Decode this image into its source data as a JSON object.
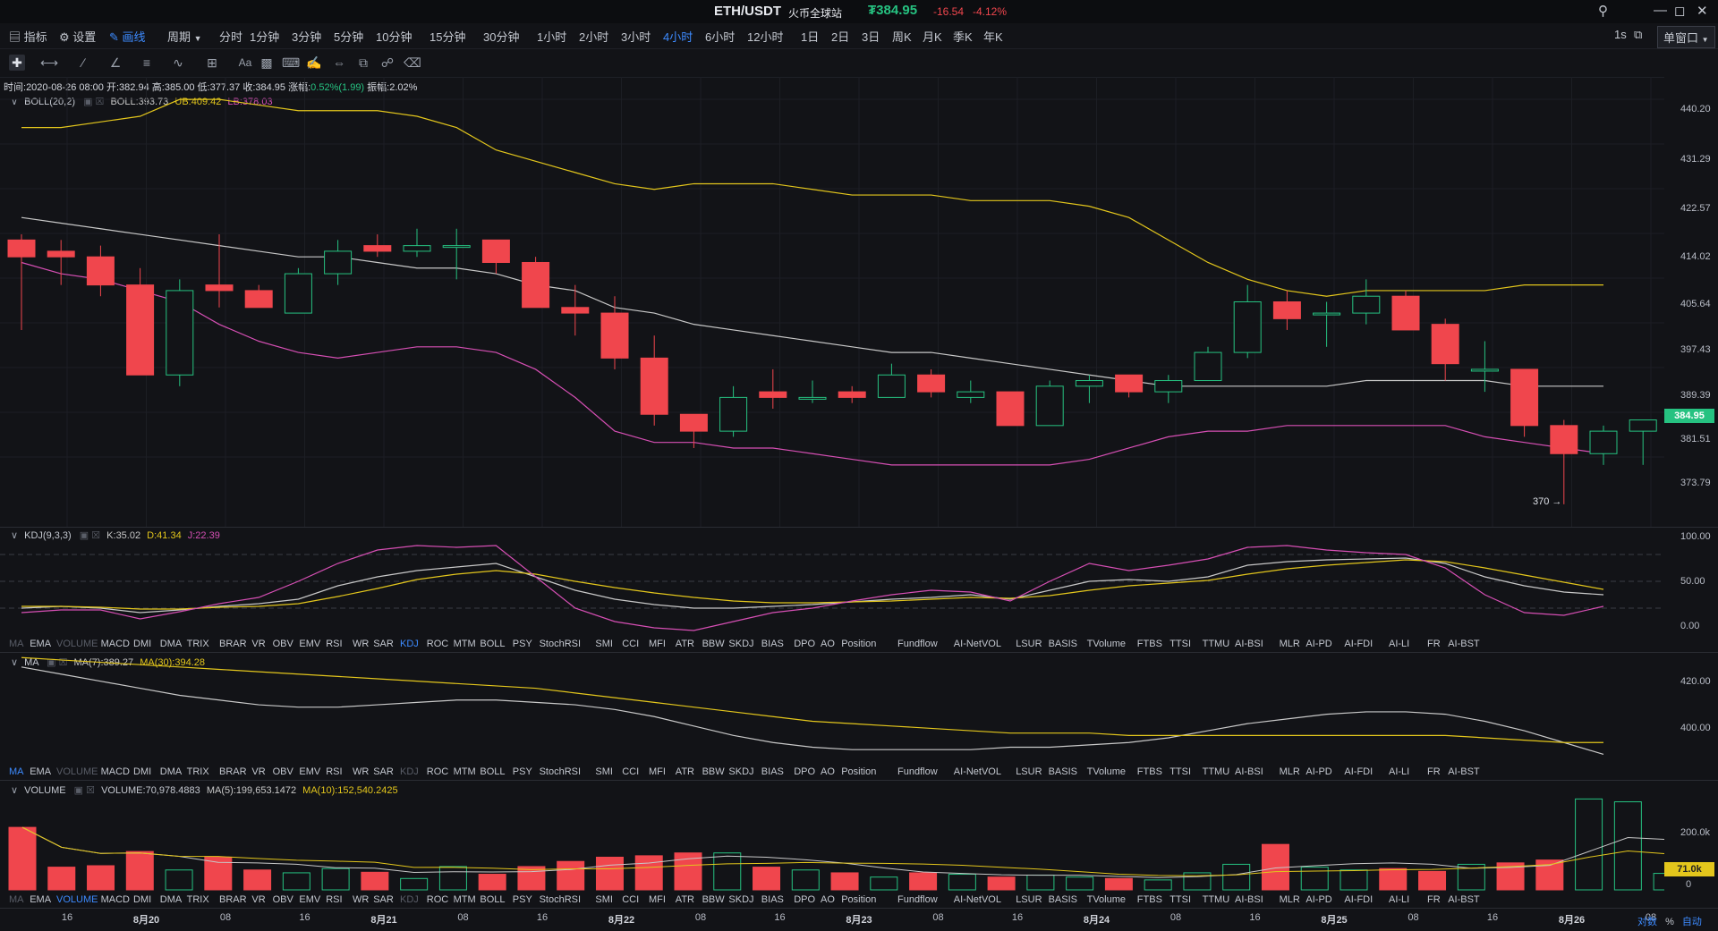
{
  "titlebar": {
    "pair": "ETH/USDT",
    "exchange": "火币全球站",
    "price": "₮384.95",
    "change": "-16.54",
    "change_pct": "-4.12%",
    "price_color": "#26c281",
    "change_color": "#f0464d"
  },
  "toolbar": {
    "indicators_label": "指标",
    "settings_label": "设置",
    "draw_label": "画线",
    "period_label": "周期",
    "periods": [
      "分时",
      "1分钟",
      "3分钟",
      "5分钟",
      "10分钟",
      "15分钟",
      "30分钟",
      "1小时",
      "2小时",
      "3小时",
      "4小时",
      "6小时",
      "12小时",
      "1日",
      "2日",
      "3日",
      "周K",
      "月K",
      "季K",
      "年K"
    ],
    "active_period": "4小时",
    "refresh": "1s",
    "window_mode": "单窗口"
  },
  "drawing_tools": [
    "crosshair-icon",
    "horizontal-line-icon",
    "trend-line-icon",
    "angle-icon",
    "parallel-lines-icon",
    "wave-icon",
    "grid-icon",
    "text-icon",
    "pattern-icon",
    "ruler-icon",
    "pen-icon",
    "measure-icon",
    "lock-icon",
    "trash-icon"
  ],
  "text_tool_label": "Aa",
  "ohlc_info": {
    "time_label": "时间:",
    "time": "2020-08-26 08:00",
    "open_label": "开:",
    "open": "382.94",
    "high_label": "高:",
    "high": "385.00",
    "low_label": "低:",
    "low": "377.37",
    "close_label": "收:",
    "close": "384.95",
    "change_label": "涨幅:",
    "change": "0.52%(1.99)",
    "amp_label": "振幅:",
    "amp": "2.02%"
  },
  "boll_legend": {
    "name": "BOLL(20,2)",
    "boll": "BOLL:393.73",
    "ub": "UB:409.42",
    "lb": "LB:378.03"
  },
  "kdj_legend": {
    "name": "KDJ(9,3,3)",
    "k": "K:35.02",
    "d": "D:41.34",
    "j": "J:22.39"
  },
  "ma_legend": {
    "name": "MA",
    "ma7": "MA(7):389.27",
    "ma30": "MA(30):394.28"
  },
  "vol_legend": {
    "name": "VOLUME",
    "vol": "VOLUME:70,978.4883",
    "ma5": "MA(5):199,653.1472",
    "ma10": "MA(10):152,540.2425"
  },
  "indicator_tabs": [
    "MA",
    "EMA",
    "VOLUME",
    "MACD",
    "DMI",
    "DMA",
    "TRIX",
    "BRAR",
    "VR",
    "OBV",
    "EMV",
    "RSI",
    "WR",
    "SAR",
    "KDJ",
    "ROC",
    "MTM",
    "BOLL",
    "PSY",
    "StochRSI",
    "SMI",
    "CCI",
    "MFI",
    "ATR",
    "BBW",
    "SKDJ",
    "BIAS",
    "DPO",
    "AO",
    "Position",
    "Fundflow",
    "AI-NetVOL",
    "LSUR",
    "BASIS",
    "TVolume",
    "FTBS",
    "TTSI",
    "TTMU",
    "AI-BSI",
    "MLR",
    "AI-PD",
    "AI-FDI",
    "AI-LI",
    "FR",
    "AI-BST"
  ],
  "price_axis": [
    "440.20",
    "431.29",
    "422.57",
    "414.02",
    "405.64",
    "397.43",
    "389.39",
    "381.51",
    "373.79"
  ],
  "current_price_tag": "384.95",
  "low_marker": "370 →",
  "kdj_axis": [
    "100.00",
    "50.00",
    "0.00"
  ],
  "ma_axis": [
    "420.00",
    "400.00"
  ],
  "vol_axis": [
    "200.0k",
    "0"
  ],
  "vol_tag": "71.0k",
  "time_axis": [
    "16",
    "8月20",
    "08",
    "16",
    "8月21",
    "08",
    "16",
    "8月22",
    "08",
    "16",
    "8月23",
    "08",
    "16",
    "8月24",
    "08",
    "16",
    "8月25",
    "08",
    "16",
    "8月26",
    "08"
  ],
  "bottom_right": {
    "log": "对数",
    "pct": "%",
    "auto": "自动"
  },
  "colors": {
    "up": "#26c281",
    "down": "#f0464d",
    "ub": "#e3c61c",
    "mid": "#c8c8c8",
    "lb": "#d64fb4",
    "accent": "#3d8bff"
  },
  "chart_data": {
    "type": "candlestick",
    "candles": [
      {
        "o": 417,
        "h": 418,
        "l": 401,
        "c": 414
      },
      {
        "o": 415,
        "h": 417,
        "l": 409,
        "c": 414
      },
      {
        "o": 414,
        "h": 416,
        "l": 407,
        "c": 409
      },
      {
        "o": 409,
        "h": 412,
        "l": 393,
        "c": 393
      },
      {
        "o": 393,
        "h": 410,
        "l": 391,
        "c": 408
      },
      {
        "o": 409,
        "h": 418,
        "l": 405,
        "c": 408
      },
      {
        "o": 408,
        "h": 409,
        "l": 405,
        "c": 405
      },
      {
        "o": 404,
        "h": 412,
        "l": 404,
        "c": 411
      },
      {
        "o": 411,
        "h": 417,
        "l": 409,
        "c": 415
      },
      {
        "o": 416,
        "h": 418,
        "l": 414,
        "c": 415
      },
      {
        "o": 415,
        "h": 419,
        "l": 414,
        "c": 416
      },
      {
        "o": 416,
        "h": 419,
        "l": 410,
        "c": 416
      },
      {
        "o": 417,
        "h": 417,
        "l": 411,
        "c": 413
      },
      {
        "o": 413,
        "h": 414,
        "l": 405,
        "c": 405
      },
      {
        "o": 405,
        "h": 409,
        "l": 400,
        "c": 404
      },
      {
        "o": 404,
        "h": 407,
        "l": 394,
        "c": 396
      },
      {
        "o": 396,
        "h": 400,
        "l": 384,
        "c": 386
      },
      {
        "o": 386,
        "h": 386,
        "l": 380,
        "c": 383
      },
      {
        "o": 383,
        "h": 391,
        "l": 382,
        "c": 389
      },
      {
        "o": 390,
        "h": 394,
        "l": 387,
        "c": 389
      },
      {
        "o": 389,
        "h": 392,
        "l": 388,
        "c": 389
      },
      {
        "o": 390,
        "h": 391,
        "l": 388,
        "c": 389
      },
      {
        "o": 389,
        "h": 395,
        "l": 389,
        "c": 393
      },
      {
        "o": 393,
        "h": 394,
        "l": 389,
        "c": 390
      },
      {
        "o": 389,
        "h": 392,
        "l": 388,
        "c": 390
      },
      {
        "o": 390,
        "h": 390,
        "l": 384,
        "c": 384
      },
      {
        "o": 384,
        "h": 392,
        "l": 384,
        "c": 391
      },
      {
        "o": 391,
        "h": 393,
        "l": 388,
        "c": 392
      },
      {
        "o": 393,
        "h": 393,
        "l": 389,
        "c": 390
      },
      {
        "o": 390,
        "h": 393,
        "l": 388,
        "c": 392
      },
      {
        "o": 392,
        "h": 398,
        "l": 392,
        "c": 397
      },
      {
        "o": 397,
        "h": 409,
        "l": 396,
        "c": 406
      },
      {
        "o": 406,
        "h": 408,
        "l": 401,
        "c": 403
      },
      {
        "o": 404,
        "h": 406,
        "l": 398,
        "c": 404
      },
      {
        "o": 404,
        "h": 410,
        "l": 402,
        "c": 407
      },
      {
        "o": 407,
        "h": 408,
        "l": 401,
        "c": 401
      },
      {
        "o": 402,
        "h": 403,
        "l": 392,
        "c": 395
      },
      {
        "o": 394,
        "h": 399,
        "l": 390,
        "c": 394
      },
      {
        "o": 394,
        "h": 394,
        "l": 382,
        "c": 384
      },
      {
        "o": 384,
        "h": 385,
        "l": 370,
        "c": 379
      },
      {
        "o": 379,
        "h": 384,
        "l": 377,
        "c": 383
      },
      {
        "o": 383,
        "h": 385,
        "l": 377,
        "c": 385
      }
    ],
    "ub": [
      437,
      437,
      438,
      439,
      442,
      442,
      441,
      440,
      440,
      440,
      439,
      437,
      433,
      431,
      429,
      427,
      426,
      427,
      427,
      427,
      426,
      425,
      425,
      425,
      424,
      424,
      424,
      423,
      421,
      417,
      413,
      410,
      408,
      407,
      408,
      408,
      408,
      408,
      409,
      409,
      409
    ],
    "mid": [
      421,
      420,
      419,
      418,
      417,
      416,
      415,
      414,
      414,
      413,
      412,
      412,
      411,
      409,
      408,
      405,
      404,
      402,
      401,
      400,
      399,
      398,
      397,
      397,
      396,
      395,
      394,
      393,
      392,
      391,
      391,
      391,
      391,
      391,
      392,
      392,
      392,
      392,
      391,
      391,
      391
    ],
    "lb": [
      413,
      411,
      410,
      408,
      406,
      402,
      399,
      397,
      396,
      397,
      398,
      398,
      397,
      394,
      389,
      383,
      381,
      381,
      380,
      380,
      379,
      378,
      377,
      377,
      377,
      377,
      377,
      378,
      380,
      382,
      383,
      383,
      384,
      384,
      384,
      384,
      384,
      382,
      381,
      380,
      379
    ],
    "kdj_k": [
      20,
      22,
      20,
      15,
      18,
      22,
      25,
      30,
      45,
      55,
      62,
      66,
      70,
      55,
      40,
      30,
      24,
      20,
      20,
      22,
      24,
      27,
      30,
      32,
      35,
      30,
      40,
      50,
      52,
      50,
      55,
      68,
      72,
      74,
      75,
      76,
      70,
      55,
      45,
      38,
      35
    ],
    "kdj_d": [
      22,
      22,
      21,
      19,
      19,
      21,
      22,
      25,
      33,
      42,
      52,
      58,
      62,
      58,
      50,
      43,
      37,
      32,
      28,
      26,
      26,
      27,
      28,
      30,
      32,
      31,
      34,
      40,
      45,
      48,
      51,
      58,
      64,
      68,
      71,
      74,
      72,
      65,
      57,
      49,
      41
    ],
    "kdj_j": [
      15,
      18,
      18,
      8,
      16,
      25,
      32,
      50,
      70,
      85,
      90,
      88,
      90,
      55,
      20,
      5,
      -2,
      -5,
      5,
      15,
      20,
      28,
      35,
      40,
      38,
      28,
      50,
      70,
      62,
      68,
      75,
      88,
      90,
      85,
      82,
      80,
      65,
      35,
      15,
      12,
      22
    ],
    "ma7": [
      426,
      423,
      420,
      417,
      414,
      412,
      410,
      409,
      409,
      410,
      411,
      412,
      412,
      411,
      410,
      408,
      405,
      401,
      397,
      394,
      392,
      391,
      391,
      391,
      391,
      392,
      392,
      393,
      394,
      396,
      399,
      402,
      404,
      406,
      407,
      407,
      406,
      403,
      399,
      394,
      389
    ],
    "ma30": [
      430,
      429,
      428,
      427,
      426,
      425,
      424,
      423,
      422,
      421,
      420,
      419,
      418,
      417,
      415,
      413,
      411,
      409,
      407,
      405,
      403,
      402,
      401,
      400,
      399,
      398,
      398,
      398,
      397,
      397,
      397,
      397,
      397,
      397,
      397,
      397,
      397,
      396,
      395,
      394,
      394
    ],
    "volume": [
      220,
      80,
      85,
      135,
      70,
      115,
      70,
      60,
      75,
      62,
      40,
      82,
      55,
      82,
      100,
      115,
      120,
      130,
      130,
      80,
      70,
      60,
      45,
      60,
      55,
      45,
      52,
      45,
      40,
      35,
      60,
      90,
      160,
      80,
      70,
      75,
      65,
      90,
      95,
      105,
      320,
      310,
      58,
      48
    ],
    "vol_ma5": [],
    "vol_ma10": [],
    "price_range": [
      366,
      446
    ],
    "kdj_range": [
      -10,
      110
    ],
    "ma_range": [
      385,
      432
    ]
  }
}
